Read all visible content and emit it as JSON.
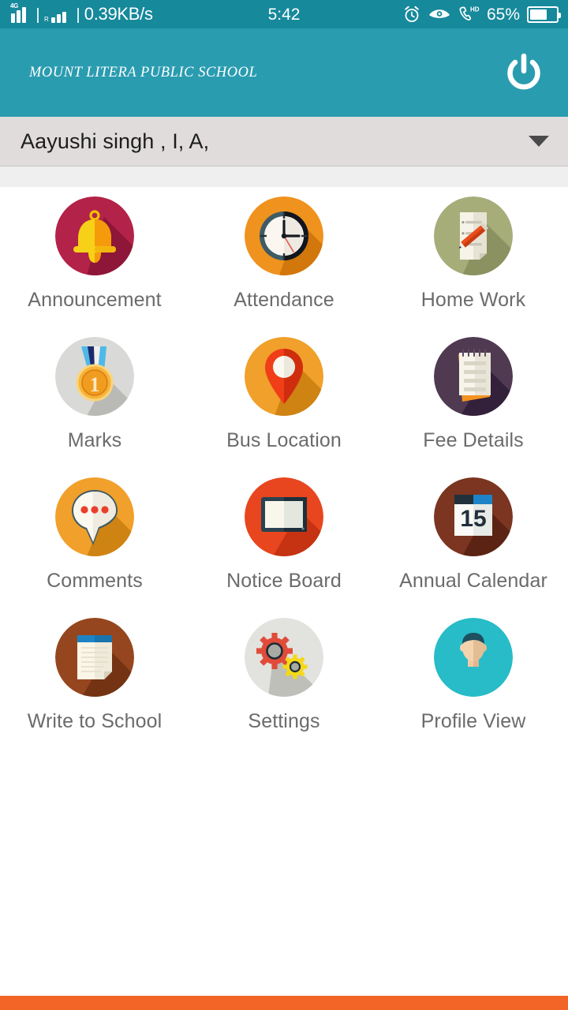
{
  "status_bar": {
    "network_type": "4G",
    "roaming_label": "R",
    "network_speed": "0.39KB/s",
    "time": "5:42",
    "battery_percent": "65%",
    "battery_level": 65,
    "icons": [
      "alarm-icon",
      "eye-care-icon",
      "volte-hd-icon",
      "battery-icon"
    ],
    "background_color": "#16899B"
  },
  "header": {
    "school_name": "MOUNT LITERA PUBLIC SCHOOL",
    "power_button_label": "power-button",
    "background_color": "#2A9CB0"
  },
  "student_selector": {
    "selected": "Aayushi singh , I, A,",
    "caret_icon": "chevron-down-icon",
    "background_color": "#E1DCDC"
  },
  "grid": {
    "items": [
      {
        "label": "Announcement",
        "icon": "bell-icon",
        "circle_color": "#B32248",
        "shadow_color": "#8E1639"
      },
      {
        "label": "Attendance",
        "icon": "clock-icon",
        "circle_color": "#F0921E",
        "shadow_color": "#D2770C"
      },
      {
        "label": "Home Work",
        "icon": "homework-icon",
        "circle_color": "#A7AD79",
        "shadow_color": "#8B9160"
      },
      {
        "label": "Marks",
        "icon": "medal-icon",
        "circle_color": "#D9DAD7",
        "shadow_color": "#B9BAB6"
      },
      {
        "label": "Bus Location",
        "icon": "map-pin-icon",
        "circle_color": "#F0A02B",
        "shadow_color": "#CE8313"
      },
      {
        "label": "Fee Details",
        "icon": "notepad-icon",
        "circle_color": "#4F3A52",
        "shadow_color": "#33203A"
      },
      {
        "label": "Comments",
        "icon": "chat-bubble-icon",
        "circle_color": "#F0A02B",
        "shadow_color": "#CE8313"
      },
      {
        "label": "Notice Board",
        "icon": "board-icon",
        "circle_color": "#E8461E",
        "shadow_color": "#C53312"
      },
      {
        "label": "Annual Calendar",
        "icon": "calendar-icon",
        "circle_color": "#7B3520",
        "shadow_color": "#5B2314",
        "calendar_day": "15"
      },
      {
        "label": "Write to School",
        "icon": "notebook-icon",
        "circle_color": "#96461F",
        "shadow_color": "#743414"
      },
      {
        "label": "Settings",
        "icon": "gears-icon",
        "circle_color": "#E2E3DE",
        "shadow_color": "#B6B9B1"
      },
      {
        "label": "Profile View",
        "icon": "person-icon",
        "circle_color": "#27BCC7",
        "shadow_color": "#27BCC7"
      }
    ]
  },
  "bottom_bar": {
    "color": "#F26527"
  }
}
